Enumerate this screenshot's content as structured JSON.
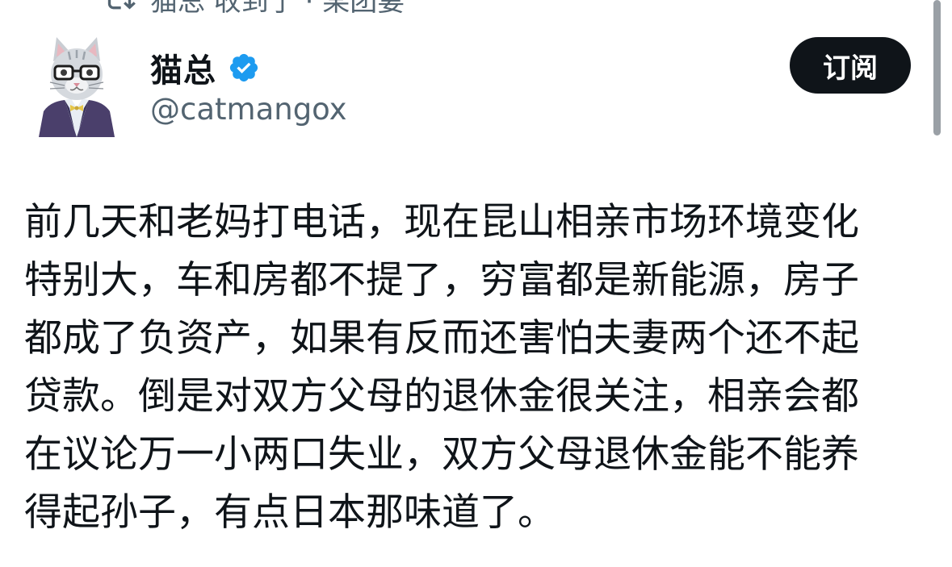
{
  "social_context": {
    "text": "猫总 收到了 · 某团妻",
    "icon": "retweet-icon"
  },
  "author": {
    "display_name": "猫总",
    "handle": "@catmangox",
    "verified": true,
    "verified_color": "#1d9bf0",
    "avatar_icon": "cat-avatar-icon"
  },
  "actions": {
    "subscribe_label": "订阅"
  },
  "post": {
    "lines": [
      "前几天和老妈打电话，现在昆山相亲市场环境变化",
      "特别大，车和房都不提了，穷富都是新能源，房子",
      "都成了负资产，如果有反而还害怕夫妻两个还不起",
      "贷款。倒是对双方父母的退休金很关注，相亲会都",
      "在议论万一小两口失业，双方父母退休金能不能养",
      "得起孙子，有点日本那味道了。"
    ]
  },
  "colors": {
    "text": "#0f1419",
    "secondary": "#536471",
    "button_bg": "#0f1419",
    "button_text": "#ffffff"
  }
}
